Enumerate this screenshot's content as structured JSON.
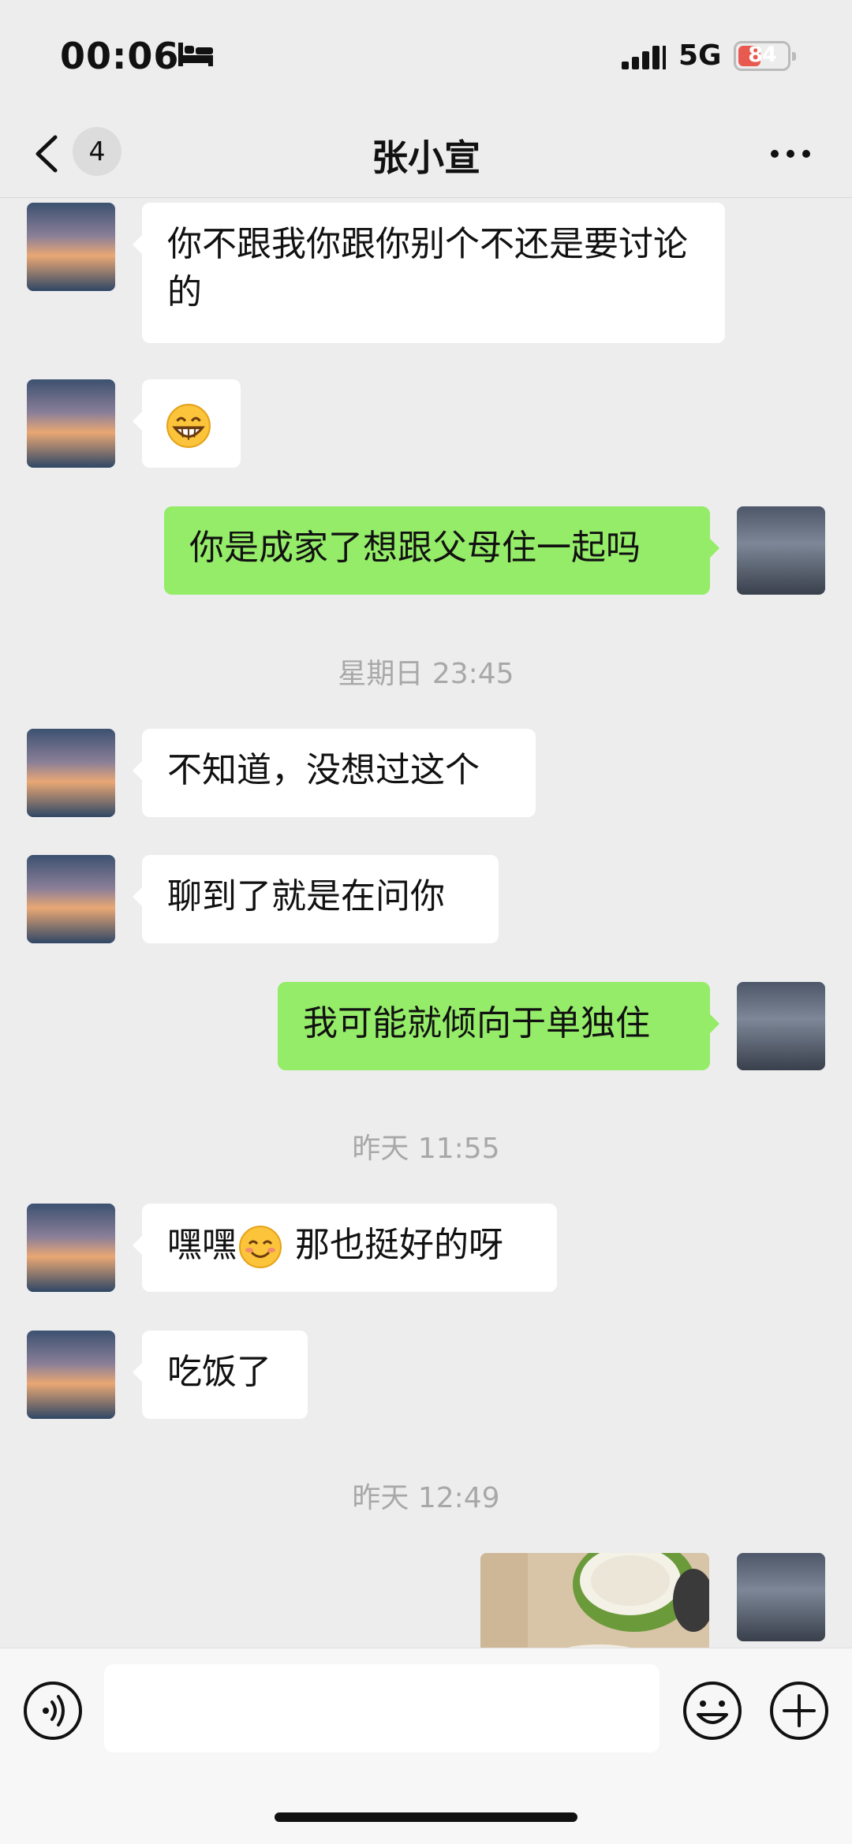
{
  "status_bar": {
    "time": "00:06",
    "network": "5G",
    "battery": "84"
  },
  "nav": {
    "back_count": "4",
    "title": "张小宣"
  },
  "messages": [
    {
      "text": "你不跟我你跟你别个不还是要讨论的"
    },
    {
      "text": ""
    },
    {
      "text": "你是成家了想跟父母住一起吗"
    },
    {
      "time": "星期日 23:45"
    },
    {
      "text": "不知道，没想过这个"
    },
    {
      "text": "聊到了就是在问你"
    },
    {
      "text": "我可能就倾向于单独住"
    },
    {
      "time": "昨天 11:55"
    },
    {
      "text_before": "嘿嘿",
      "text_after": " 那也挺好的呀"
    },
    {
      "text": "吃饭了"
    },
    {
      "time": "昨天 12:49"
    }
  ],
  "input": {
    "placeholder": ""
  },
  "colors": {
    "outgoing_bubble": "#95ec69",
    "incoming_bubble": "#ffffff",
    "background": "#ededed",
    "timestamp": "#a8a8a8"
  }
}
